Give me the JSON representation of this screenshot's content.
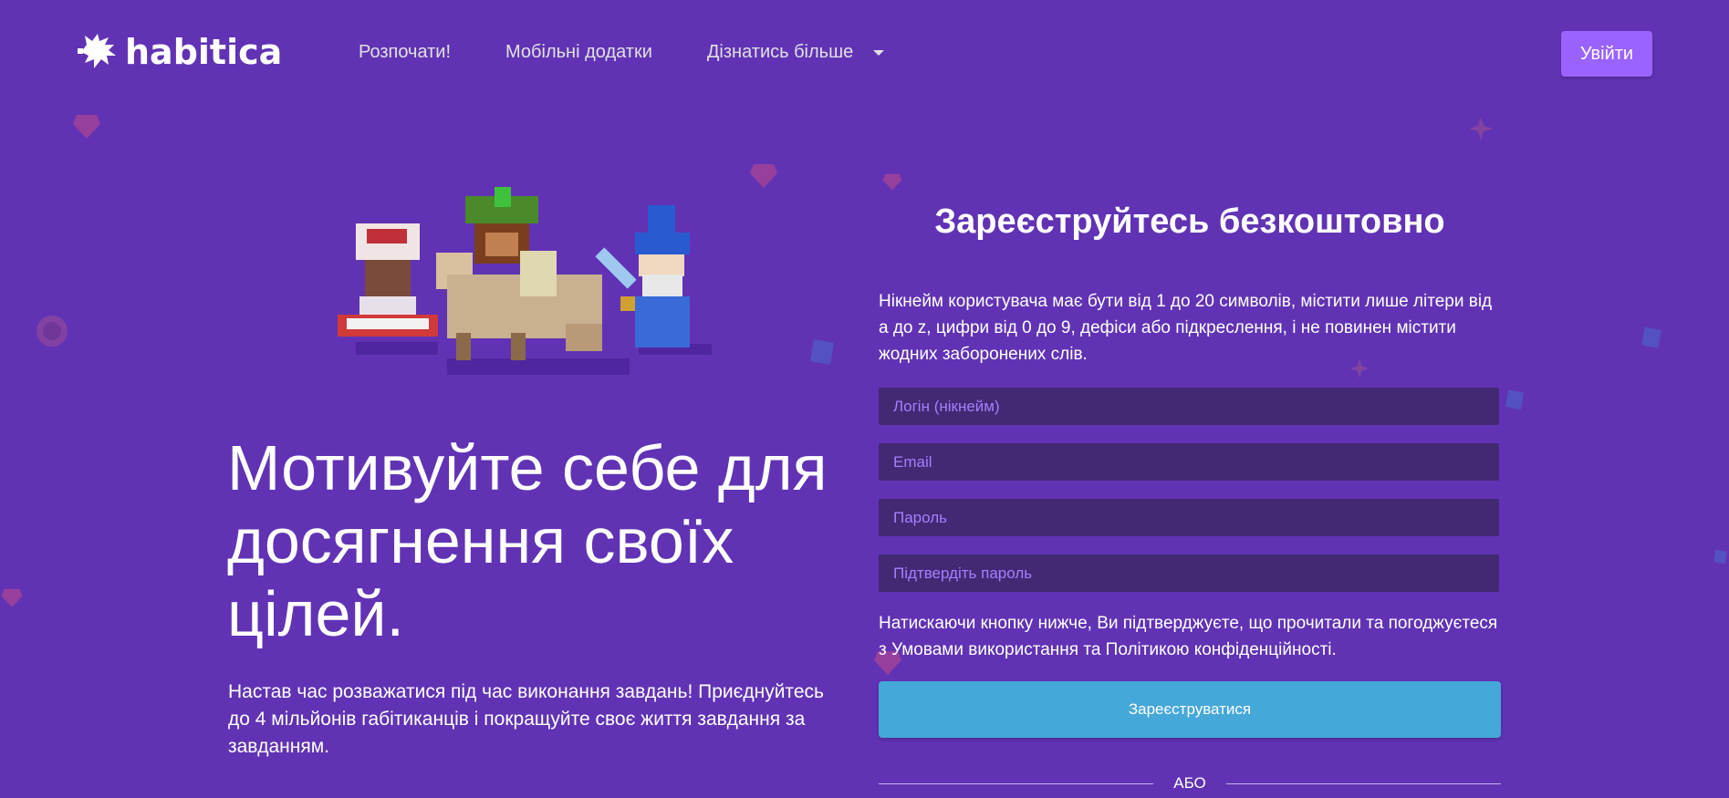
{
  "header": {
    "logo_text": "habitica",
    "nav": [
      {
        "label": "Розпочати!"
      },
      {
        "label": "Мобільні додатки"
      },
      {
        "label": "Дізнатись більше"
      }
    ],
    "login_label": "Увійти"
  },
  "hero": {
    "headline": "Мотивуйте себе для досягнення своїх цілей.",
    "subtext": "Настав час розважатися під час виконання завдань! Приєднуйтесь до 4 мільйонів габітиканців і покращуйте своє життя завдання за завданням."
  },
  "signup": {
    "title": "Зареєструйтесь безкоштовно",
    "hint": "Нікнейм користувача має бути від 1 до 20 символів, містити лише літери від а до z, цифри від 0 до 9, дефіси або підкреслення, і не повинен містити жодних заборонених слів.",
    "fields": {
      "username_placeholder": "Логін (нікнейм)",
      "email_placeholder": "Email",
      "password_placeholder": "Пароль",
      "confirm_placeholder": "Підтвердіть пароль"
    },
    "legal": "Натискаючи кнопку нижче, Ви підтверджуєте, що прочитали та погоджуєтеся з Умовами використання та Політикою конфіденційності.",
    "submit_label": "Зареєструватися",
    "divider_text": "АБО"
  },
  "colors": {
    "background": "#6133b4",
    "field_bg": "#432874",
    "login_button": "#9a62ff",
    "signup_button": "#46a7d9"
  },
  "icons": [
    "habitica-logo-icon",
    "chevron-down-icon"
  ]
}
